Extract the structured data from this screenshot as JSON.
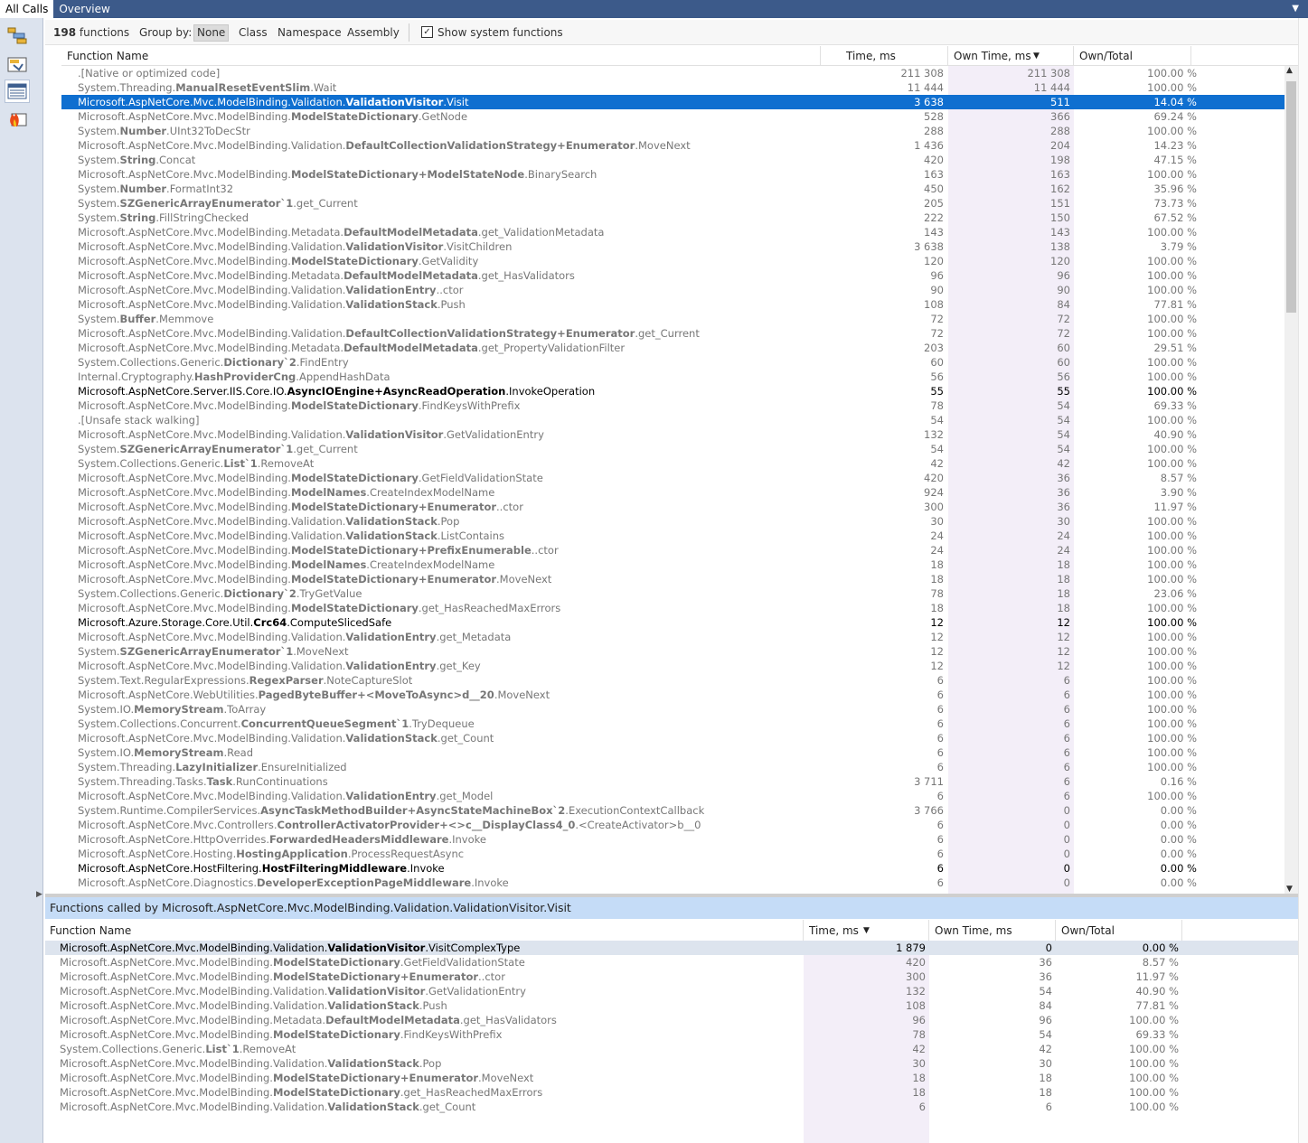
{
  "tabs": [
    "All Calls",
    "Overview"
  ],
  "toolbar": {
    "count": "198",
    "count_label": "functions",
    "group_label": "Group by:",
    "groups": [
      "None",
      "Class",
      "Namespace",
      "Assembly"
    ],
    "selected_group": "None",
    "show_system_label": "Show system functions",
    "show_system_checked": true
  },
  "main_table": {
    "headers": {
      "name": "Function Name",
      "time": "Time, ms",
      "own_time": "Own Time, ms",
      "own_total": "Own/Total"
    },
    "rows": [
      {
        "pre": ".[Native or optimized code]",
        "bold": "",
        "post": "",
        "time": "211 308",
        "own": "211 308",
        "pct": "100.00 %"
      },
      {
        "pre": "System.Threading.",
        "bold": "ManualResetEventSlim",
        "post": ".Wait",
        "time": "11 444",
        "own": "11 444",
        "pct": "100.00 %"
      },
      {
        "pre": "Microsoft.AspNetCore.Mvc.ModelBinding.Validation.",
        "bold": "ValidationVisitor",
        "post": ".Visit",
        "time": "3 638",
        "own": "511",
        "pct": "14.04 %",
        "selected": true
      },
      {
        "pre": "Microsoft.AspNetCore.Mvc.ModelBinding.",
        "bold": "ModelStateDictionary",
        "post": ".GetNode",
        "time": "528",
        "own": "366",
        "pct": "69.24 %"
      },
      {
        "pre": "System.",
        "bold": "Number",
        "post": ".UInt32ToDecStr",
        "time": "288",
        "own": "288",
        "pct": "100.00 %"
      },
      {
        "pre": "Microsoft.AspNetCore.Mvc.ModelBinding.Validation.",
        "bold": "DefaultCollectionValidationStrategy+Enumerator",
        "post": ".MoveNext",
        "time": "1 436",
        "own": "204",
        "pct": "14.23 %"
      },
      {
        "pre": "System.",
        "bold": "String",
        "post": ".Concat",
        "time": "420",
        "own": "198",
        "pct": "47.15 %"
      },
      {
        "pre": "Microsoft.AspNetCore.Mvc.ModelBinding.",
        "bold": "ModelStateDictionary+ModelStateNode",
        "post": ".BinarySearch",
        "time": "163",
        "own": "163",
        "pct": "100.00 %"
      },
      {
        "pre": "System.",
        "bold": "Number",
        "post": ".FormatInt32",
        "time": "450",
        "own": "162",
        "pct": "35.96 %"
      },
      {
        "pre": "System.",
        "bold": "SZGenericArrayEnumerator`1",
        "post": ".get_Current",
        "time": "205",
        "own": "151",
        "pct": "73.73 %"
      },
      {
        "pre": "System.",
        "bold": "String",
        "post": ".FillStringChecked",
        "time": "222",
        "own": "150",
        "pct": "67.52 %"
      },
      {
        "pre": "Microsoft.AspNetCore.Mvc.ModelBinding.Metadata.",
        "bold": "DefaultModelMetadata",
        "post": ".get_ValidationMetadata",
        "time": "143",
        "own": "143",
        "pct": "100.00 %"
      },
      {
        "pre": "Microsoft.AspNetCore.Mvc.ModelBinding.Validation.",
        "bold": "ValidationVisitor",
        "post": ".VisitChildren",
        "time": "3 638",
        "own": "138",
        "pct": "3.79 %"
      },
      {
        "pre": "Microsoft.AspNetCore.Mvc.ModelBinding.",
        "bold": "ModelStateDictionary",
        "post": ".GetValidity",
        "time": "120",
        "own": "120",
        "pct": "100.00 %"
      },
      {
        "pre": "Microsoft.AspNetCore.Mvc.ModelBinding.Metadata.",
        "bold": "DefaultModelMetadata",
        "post": ".get_HasValidators",
        "time": "96",
        "own": "96",
        "pct": "100.00 %"
      },
      {
        "pre": "Microsoft.AspNetCore.Mvc.ModelBinding.Validation.",
        "bold": "ValidationEntry",
        "post": "..ctor",
        "time": "90",
        "own": "90",
        "pct": "100.00 %"
      },
      {
        "pre": "Microsoft.AspNetCore.Mvc.ModelBinding.Validation.",
        "bold": "ValidationStack",
        "post": ".Push",
        "time": "108",
        "own": "84",
        "pct": "77.81 %"
      },
      {
        "pre": "System.",
        "bold": "Buffer",
        "post": ".Memmove",
        "time": "72",
        "own": "72",
        "pct": "100.00 %"
      },
      {
        "pre": "Microsoft.AspNetCore.Mvc.ModelBinding.Validation.",
        "bold": "DefaultCollectionValidationStrategy+Enumerator",
        "post": ".get_Current",
        "time": "72",
        "own": "72",
        "pct": "100.00 %"
      },
      {
        "pre": "Microsoft.AspNetCore.Mvc.ModelBinding.Metadata.",
        "bold": "DefaultModelMetadata",
        "post": ".get_PropertyValidationFilter",
        "time": "203",
        "own": "60",
        "pct": "29.51 %"
      },
      {
        "pre": "System.Collections.Generic.",
        "bold": "Dictionary`2",
        "post": ".FindEntry",
        "time": "60",
        "own": "60",
        "pct": "100.00 %"
      },
      {
        "pre": "Internal.Cryptography.",
        "bold": "HashProviderCng",
        "post": ".AppendHashData",
        "time": "56",
        "own": "56",
        "pct": "100.00 %"
      },
      {
        "pre": "Microsoft.AspNetCore.Server.IIS.Core.IO.",
        "bold": "AsyncIOEngine+AsyncReadOperation",
        "post": ".InvokeOperation",
        "time": "55",
        "own": "55",
        "pct": "100.00 %",
        "dark": true
      },
      {
        "pre": "Microsoft.AspNetCore.Mvc.ModelBinding.",
        "bold": "ModelStateDictionary",
        "post": ".FindKeysWithPrefix",
        "time": "78",
        "own": "54",
        "pct": "69.33 %"
      },
      {
        "pre": ".[Unsafe stack walking]",
        "bold": "",
        "post": "",
        "time": "54",
        "own": "54",
        "pct": "100.00 %"
      },
      {
        "pre": "Microsoft.AspNetCore.Mvc.ModelBinding.Validation.",
        "bold": "ValidationVisitor",
        "post": ".GetValidationEntry",
        "time": "132",
        "own": "54",
        "pct": "40.90 %"
      },
      {
        "pre": "System.",
        "bold": "SZGenericArrayEnumerator`1",
        "post": ".get_Current",
        "time": "54",
        "own": "54",
        "pct": "100.00 %"
      },
      {
        "pre": "System.Collections.Generic.",
        "bold": "List`1",
        "post": ".RemoveAt",
        "time": "42",
        "own": "42",
        "pct": "100.00 %"
      },
      {
        "pre": "Microsoft.AspNetCore.Mvc.ModelBinding.",
        "bold": "ModelStateDictionary",
        "post": ".GetFieldValidationState",
        "time": "420",
        "own": "36",
        "pct": "8.57 %"
      },
      {
        "pre": "Microsoft.AspNetCore.Mvc.ModelBinding.",
        "bold": "ModelNames",
        "post": ".CreateIndexModelName",
        "time": "924",
        "own": "36",
        "pct": "3.90 %"
      },
      {
        "pre": "Microsoft.AspNetCore.Mvc.ModelBinding.",
        "bold": "ModelStateDictionary+Enumerator",
        "post": "..ctor",
        "time": "300",
        "own": "36",
        "pct": "11.97 %"
      },
      {
        "pre": "Microsoft.AspNetCore.Mvc.ModelBinding.Validation.",
        "bold": "ValidationStack",
        "post": ".Pop",
        "time": "30",
        "own": "30",
        "pct": "100.00 %"
      },
      {
        "pre": "Microsoft.AspNetCore.Mvc.ModelBinding.Validation.",
        "bold": "ValidationStack",
        "post": ".ListContains",
        "time": "24",
        "own": "24",
        "pct": "100.00 %"
      },
      {
        "pre": "Microsoft.AspNetCore.Mvc.ModelBinding.",
        "bold": "ModelStateDictionary+PrefixEnumerable",
        "post": "..ctor",
        "time": "24",
        "own": "24",
        "pct": "100.00 %"
      },
      {
        "pre": "Microsoft.AspNetCore.Mvc.ModelBinding.",
        "bold": "ModelNames",
        "post": ".CreateIndexModelName",
        "time": "18",
        "own": "18",
        "pct": "100.00 %"
      },
      {
        "pre": "Microsoft.AspNetCore.Mvc.ModelBinding.",
        "bold": "ModelStateDictionary+Enumerator",
        "post": ".MoveNext",
        "time": "18",
        "own": "18",
        "pct": "100.00 %"
      },
      {
        "pre": "System.Collections.Generic.",
        "bold": "Dictionary`2",
        "post": ".TryGetValue",
        "time": "78",
        "own": "18",
        "pct": "23.06 %"
      },
      {
        "pre": "Microsoft.AspNetCore.Mvc.ModelBinding.",
        "bold": "ModelStateDictionary",
        "post": ".get_HasReachedMaxErrors",
        "time": "18",
        "own": "18",
        "pct": "100.00 %"
      },
      {
        "pre": "Microsoft.Azure.Storage.Core.Util.",
        "bold": "Crc64",
        "post": ".ComputeSlicedSafe",
        "time": "12",
        "own": "12",
        "pct": "100.00 %",
        "dark": true
      },
      {
        "pre": "Microsoft.AspNetCore.Mvc.ModelBinding.Validation.",
        "bold": "ValidationEntry",
        "post": ".get_Metadata",
        "time": "12",
        "own": "12",
        "pct": "100.00 %"
      },
      {
        "pre": "System.",
        "bold": "SZGenericArrayEnumerator`1",
        "post": ".MoveNext",
        "time": "12",
        "own": "12",
        "pct": "100.00 %"
      },
      {
        "pre": "Microsoft.AspNetCore.Mvc.ModelBinding.Validation.",
        "bold": "ValidationEntry",
        "post": ".get_Key",
        "time": "12",
        "own": "12",
        "pct": "100.00 %"
      },
      {
        "pre": "System.Text.RegularExpressions.",
        "bold": "RegexParser",
        "post": ".NoteCaptureSlot",
        "time": "6",
        "own": "6",
        "pct": "100.00 %"
      },
      {
        "pre": "Microsoft.AspNetCore.WebUtilities.",
        "bold": "PagedByteBuffer+<MoveToAsync>d__20",
        "post": ".MoveNext",
        "time": "6",
        "own": "6",
        "pct": "100.00 %"
      },
      {
        "pre": "System.IO.",
        "bold": "MemoryStream",
        "post": ".ToArray",
        "time": "6",
        "own": "6",
        "pct": "100.00 %"
      },
      {
        "pre": "System.Collections.Concurrent.",
        "bold": "ConcurrentQueueSegment`1",
        "post": ".TryDequeue",
        "time": "6",
        "own": "6",
        "pct": "100.00 %"
      },
      {
        "pre": "Microsoft.AspNetCore.Mvc.ModelBinding.Validation.",
        "bold": "ValidationStack",
        "post": ".get_Count",
        "time": "6",
        "own": "6",
        "pct": "100.00 %"
      },
      {
        "pre": "System.IO.",
        "bold": "MemoryStream",
        "post": ".Read",
        "time": "6",
        "own": "6",
        "pct": "100.00 %"
      },
      {
        "pre": "System.Threading.",
        "bold": "LazyInitializer",
        "post": ".EnsureInitialized",
        "time": "6",
        "own": "6",
        "pct": "100.00 %"
      },
      {
        "pre": "System.Threading.Tasks.",
        "bold": "Task",
        "post": ".RunContinuations",
        "time": "3 711",
        "own": "6",
        "pct": "0.16 %"
      },
      {
        "pre": "Microsoft.AspNetCore.Mvc.ModelBinding.Validation.",
        "bold": "ValidationEntry",
        "post": ".get_Model",
        "time": "6",
        "own": "6",
        "pct": "100.00 %"
      },
      {
        "pre": "System.Runtime.CompilerServices.",
        "bold": "AsyncTaskMethodBuilder+AsyncStateMachineBox`2",
        "post": ".ExecutionContextCallback",
        "time": "3 766",
        "own": "0",
        "pct": "0.00 %"
      },
      {
        "pre": "Microsoft.AspNetCore.Mvc.Controllers.",
        "bold": "ControllerActivatorProvider+<>c__DisplayClass4_0",
        "post": ".<CreateActivator>b__0",
        "time": "6",
        "own": "0",
        "pct": "0.00 %"
      },
      {
        "pre": "Microsoft.AspNetCore.HttpOverrides.",
        "bold": "ForwardedHeadersMiddleware",
        "post": ".Invoke",
        "time": "6",
        "own": "0",
        "pct": "0.00 %"
      },
      {
        "pre": "Microsoft.AspNetCore.Hosting.",
        "bold": "HostingApplication",
        "post": ".ProcessRequestAsync",
        "time": "6",
        "own": "0",
        "pct": "0.00 %"
      },
      {
        "pre": "Microsoft.AspNetCore.HostFiltering.",
        "bold": "HostFilteringMiddleware",
        "post": ".Invoke",
        "time": "6",
        "own": "0",
        "pct": "0.00 %",
        "dark": true
      },
      {
        "pre": "Microsoft.AspNetCore.Diagnostics.",
        "bold": "DeveloperExceptionPageMiddleware",
        "post": ".Invoke",
        "time": "6",
        "own": "0",
        "pct": "0.00 %"
      }
    ]
  },
  "called_by": {
    "title_pre": "Functions  called  by  ",
    "title_target": "Microsoft.AspNetCore.Mvc.ModelBinding.Validation.ValidationVisitor.Visit",
    "headers": {
      "name": "Function Name",
      "time": "Time, ms",
      "own_time": "Own Time, ms",
      "own_total": "Own/Total"
    },
    "rows": [
      {
        "pre": "Microsoft.AspNetCore.Mvc.ModelBinding.Validation.",
        "bold": "ValidationVisitor",
        "post": ".VisitComplexType",
        "time": "1 879",
        "own": "0",
        "pct": "0.00 %",
        "highlight": true
      },
      {
        "pre": "Microsoft.AspNetCore.Mvc.ModelBinding.",
        "bold": "ModelStateDictionary",
        "post": ".GetFieldValidationState",
        "time": "420",
        "own": "36",
        "pct": "8.57 %"
      },
      {
        "pre": "Microsoft.AspNetCore.Mvc.ModelBinding.",
        "bold": "ModelStateDictionary+Enumerator",
        "post": "..ctor",
        "time": "300",
        "own": "36",
        "pct": "11.97 %"
      },
      {
        "pre": "Microsoft.AspNetCore.Mvc.ModelBinding.Validation.",
        "bold": "ValidationVisitor",
        "post": ".GetValidationEntry",
        "time": "132",
        "own": "54",
        "pct": "40.90 %"
      },
      {
        "pre": "Microsoft.AspNetCore.Mvc.ModelBinding.Validation.",
        "bold": "ValidationStack",
        "post": ".Push",
        "time": "108",
        "own": "84",
        "pct": "77.81 %"
      },
      {
        "pre": "Microsoft.AspNetCore.Mvc.ModelBinding.Metadata.",
        "bold": "DefaultModelMetadata",
        "post": ".get_HasValidators",
        "time": "96",
        "own": "96",
        "pct": "100.00 %"
      },
      {
        "pre": "Microsoft.AspNetCore.Mvc.ModelBinding.",
        "bold": "ModelStateDictionary",
        "post": ".FindKeysWithPrefix",
        "time": "78",
        "own": "54",
        "pct": "69.33 %"
      },
      {
        "pre": "System.Collections.Generic.",
        "bold": "List`1",
        "post": ".RemoveAt",
        "time": "42",
        "own": "42",
        "pct": "100.00 %"
      },
      {
        "pre": "Microsoft.AspNetCore.Mvc.ModelBinding.Validation.",
        "bold": "ValidationStack",
        "post": ".Pop",
        "time": "30",
        "own": "30",
        "pct": "100.00 %"
      },
      {
        "pre": "Microsoft.AspNetCore.Mvc.ModelBinding.",
        "bold": "ModelStateDictionary+Enumerator",
        "post": ".MoveNext",
        "time": "18",
        "own": "18",
        "pct": "100.00 %"
      },
      {
        "pre": "Microsoft.AspNetCore.Mvc.ModelBinding.",
        "bold": "ModelStateDictionary",
        "post": ".get_HasReachedMaxErrors",
        "time": "18",
        "own": "18",
        "pct": "100.00 %"
      },
      {
        "pre": "Microsoft.AspNetCore.Mvc.ModelBinding.Validation.",
        "bold": "ValidationStack",
        "post": ".get_Count",
        "time": "6",
        "own": "6",
        "pct": "100.00 %"
      }
    ]
  },
  "colors": {
    "tabbar": "#3c5a8a",
    "selection": "#0f6fd0",
    "own_column": "#f3eef8",
    "calledby_header": "#c5dcf7"
  }
}
